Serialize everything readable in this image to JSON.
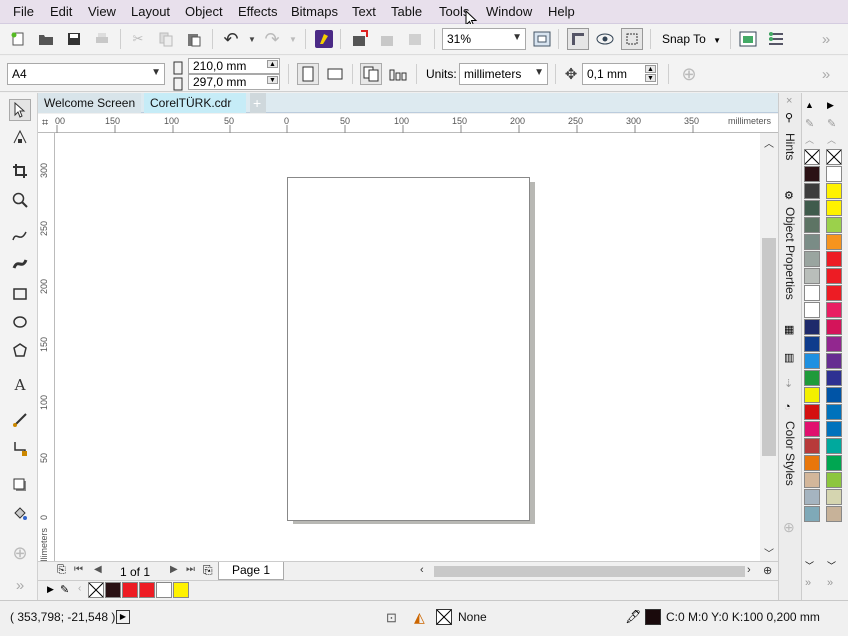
{
  "menubar": {
    "items": [
      "File",
      "Edit",
      "View",
      "Layout",
      "Object",
      "Effects",
      "Bitmaps",
      "Text",
      "Table",
      "Tools",
      "Window",
      "Help"
    ]
  },
  "toolbar1": {
    "zoom_value": "31%",
    "snap_label": "Snap To"
  },
  "toolbar2": {
    "page_size": "A4",
    "width_value": "210,0 mm",
    "height_value": "297,0 mm",
    "units_label": "Units:",
    "units_value": "millimeters",
    "nudge_value": "0,1 mm"
  },
  "tabs": {
    "welcome": "Welcome Screen",
    "document": "CorelTÜRK.cdr"
  },
  "ruler": {
    "h_labels": [
      "00",
      "150",
      "100",
      "50",
      "0",
      "50",
      "100",
      "150",
      "200",
      "250",
      "300",
      "350"
    ],
    "h_unit": "millimeters",
    "v_labels": [
      "300",
      "250",
      "200",
      "150",
      "100",
      "50",
      "0"
    ],
    "v_unit": "millimeters"
  },
  "pagenav": {
    "page_count": "1 of 1",
    "page_tab": "Page 1"
  },
  "docker": {
    "tabs": [
      "Hints",
      "Object Properties",
      "Color Styles"
    ]
  },
  "palette": {
    "left_column": [
      "#2a1114",
      "#3c3c3c",
      "#3f5b4c",
      "#5d7464",
      "#7a8c86",
      "#9aa5a0",
      "#b9beba",
      "#ffffff",
      "#ffffff",
      "#1e2a6b",
      "#0f3c8c",
      "#1e90e0",
      "#1f9a3a",
      "#f3f000",
      "#d41010",
      "#e0106e",
      "#b83a3a",
      "#e8760a",
      "#d3b69a",
      "#a5b4c0",
      "#7fa9b8"
    ],
    "right_column": [
      "#ffffff",
      "#fff200",
      "#fff200",
      "#9bd14b",
      "#f7941d",
      "#ed1c24",
      "#ed1c24",
      "#ed1c24",
      "#e91e63",
      "#d4145a",
      "#92278f",
      "#662d91",
      "#2e3192",
      "#0054a6",
      "#0072bc",
      "#0072bc",
      "#00a99d",
      "#00a651",
      "#8dc63f",
      "#d5d5b0",
      "#c7b299"
    ]
  },
  "docpalette": {
    "colors": [
      "#2a1114",
      "#ed1c24",
      "#ed1c24",
      "#ffffff",
      "#fff200"
    ]
  },
  "status": {
    "coords": "( 353,798; -21,548 )",
    "fill_label": "None",
    "outline_label": "C:0 M:0 Y:0 K:100  0,200 mm",
    "outline_color": "#1a0a0c"
  }
}
